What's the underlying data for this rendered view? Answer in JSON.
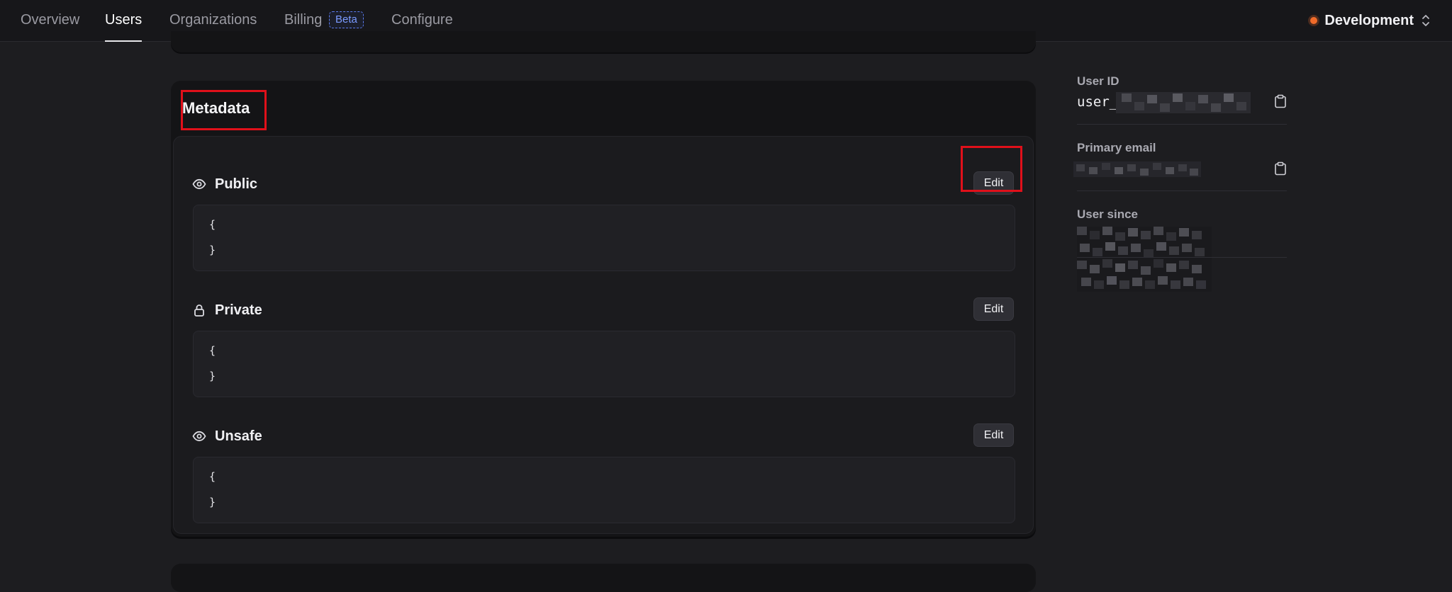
{
  "nav": {
    "tabs": [
      {
        "label": "Overview"
      },
      {
        "label": "Users"
      },
      {
        "label": "Organizations"
      },
      {
        "label": "Billing"
      },
      {
        "label": "Configure"
      }
    ],
    "billing_badge": "Beta",
    "environment": "Development",
    "active_tab": "Users"
  },
  "metadata": {
    "title": "Metadata",
    "sections": [
      {
        "label": "Public",
        "icon": "eye-icon",
        "edit_label": "Edit",
        "code_open": "{",
        "code_close": "}"
      },
      {
        "label": "Private",
        "icon": "lock-icon",
        "edit_label": "Edit",
        "code_open": "{",
        "code_close": "}"
      },
      {
        "label": "Unsafe",
        "icon": "eye-icon",
        "edit_label": "Edit",
        "code_open": "{",
        "code_close": "}"
      }
    ]
  },
  "sidebar_info": {
    "user_id_label": "User ID",
    "user_id_prefix": "user_",
    "primary_email_label": "Primary email",
    "user_since_label": "User since"
  },
  "colors": {
    "background": "#1d1d20",
    "card": "#141416",
    "accent_env": "#f06b2a",
    "badge_blue": "#7b9bff",
    "highlight_red": "#e0101a"
  }
}
